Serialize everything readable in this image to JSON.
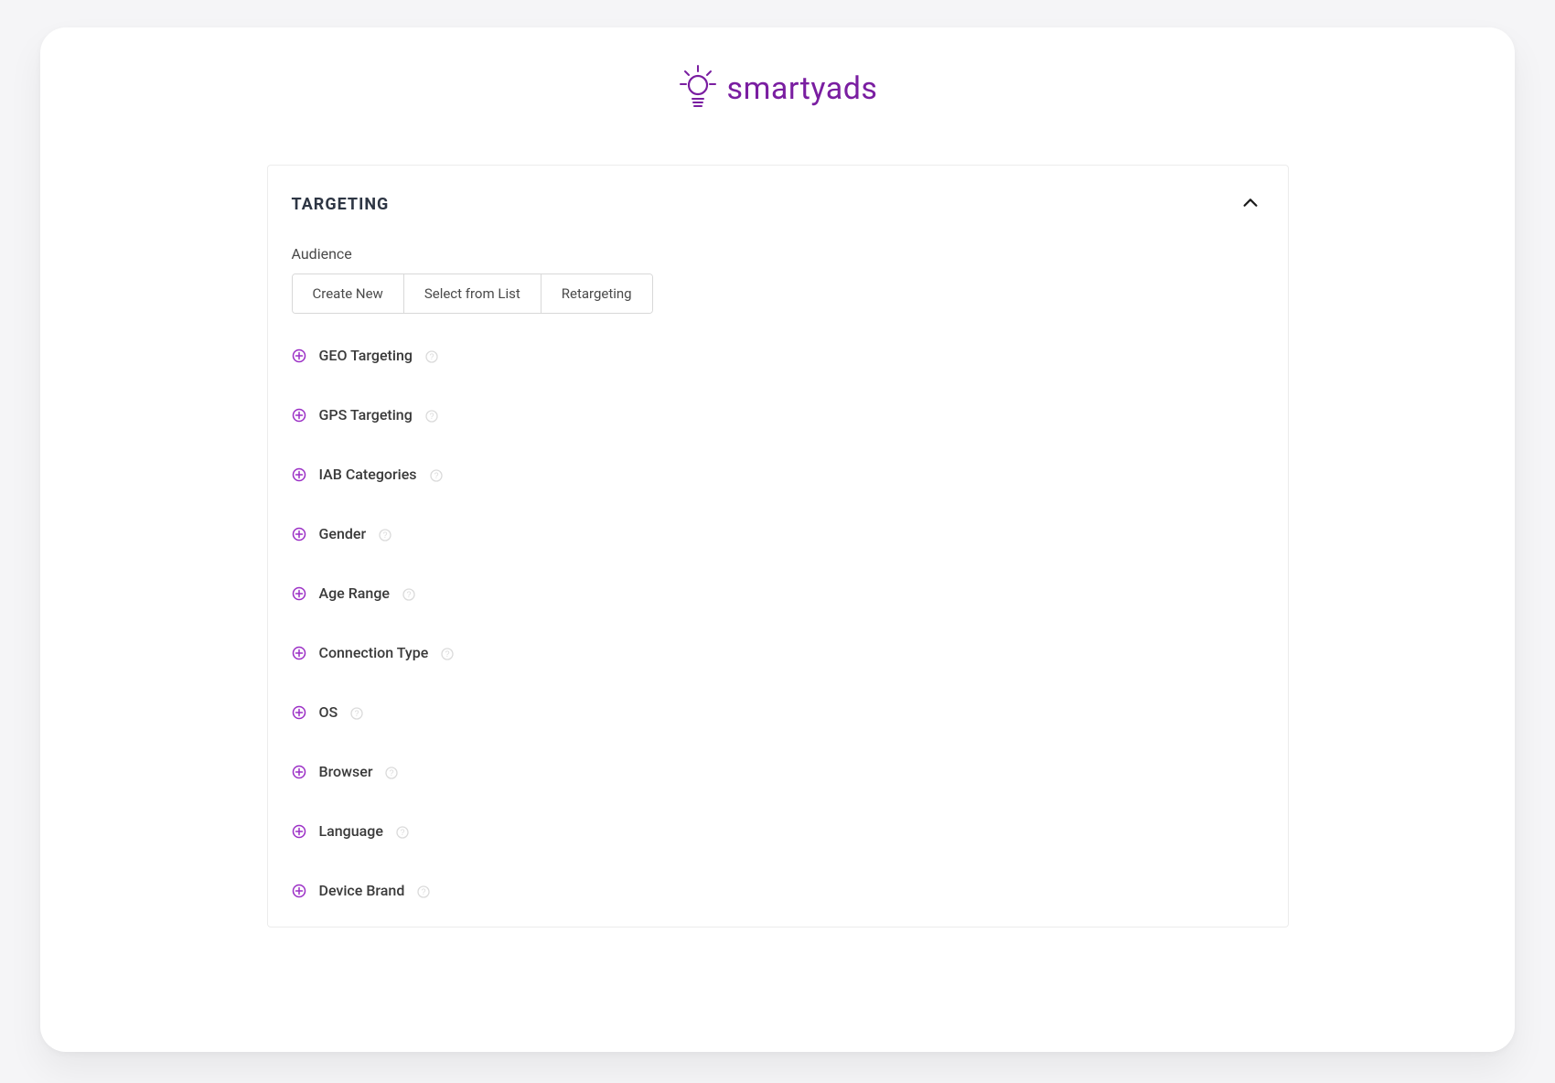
{
  "brand": {
    "name": "smartyads",
    "accent": "#7a1ea1"
  },
  "panel": {
    "title": "TARGETING",
    "audience_label": "Audience",
    "buttons": {
      "create_new": "Create New",
      "select_from_list": "Select from List",
      "retargeting": "Retargeting"
    },
    "items": [
      {
        "label": "GEO Targeting"
      },
      {
        "label": "GPS Targeting"
      },
      {
        "label": "IAB Categories"
      },
      {
        "label": "Gender"
      },
      {
        "label": "Age Range"
      },
      {
        "label": "Connection Type"
      },
      {
        "label": "OS"
      },
      {
        "label": "Browser"
      },
      {
        "label": "Language"
      },
      {
        "label": "Device Brand"
      }
    ]
  }
}
